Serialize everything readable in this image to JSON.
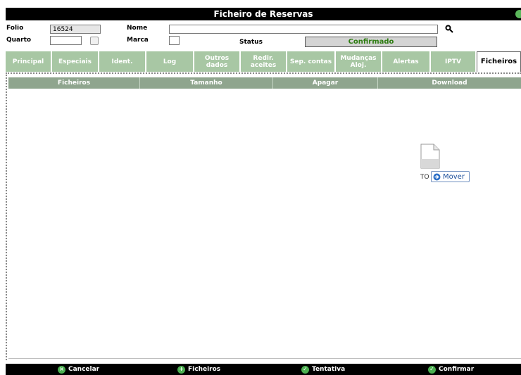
{
  "window": {
    "title": "Ficheiro de Reservas"
  },
  "form": {
    "folio_label": "Folio",
    "folio_value": "16524",
    "nome_label": "Nome",
    "nome_value": "",
    "quarto_label": "Quarto",
    "quarto_value": "",
    "marca_label": "Marca",
    "status_label": "Status",
    "status_value": "Confirmado"
  },
  "tabs": [
    {
      "label": "Principal"
    },
    {
      "label": "Especiais"
    },
    {
      "label": "Ident."
    },
    {
      "label": "Log"
    },
    {
      "label": "Outros dados"
    },
    {
      "label": "Redir. aceites"
    },
    {
      "label": "Sep. contas"
    },
    {
      "label": "Mudanças Aloj."
    },
    {
      "label": "Alertas"
    },
    {
      "label": "IPTV"
    },
    {
      "label": "Ficheiros",
      "active": true
    }
  ],
  "table": {
    "columns": [
      "Ficheiros",
      "Tamanho",
      "Apagar",
      "Download"
    ]
  },
  "drag": {
    "file_label": "TO",
    "mover_label": "Mover"
  },
  "footer": {
    "cancel_label": "Cancelar",
    "files_label": "Ficheiros",
    "tentativa_label": "Tentativa",
    "confirm_label": "Confirmar"
  },
  "colors": {
    "tab_bg": "#a8c7a4",
    "header_bg": "#8fa58e",
    "status_text": "#2e7d12"
  },
  "icons": {
    "search": "search-icon",
    "cancel": "cancel-icon",
    "add": "add-icon",
    "check": "check-icon",
    "document": "document-icon",
    "arrow": "arrow-right-icon",
    "help": "help-icon"
  }
}
